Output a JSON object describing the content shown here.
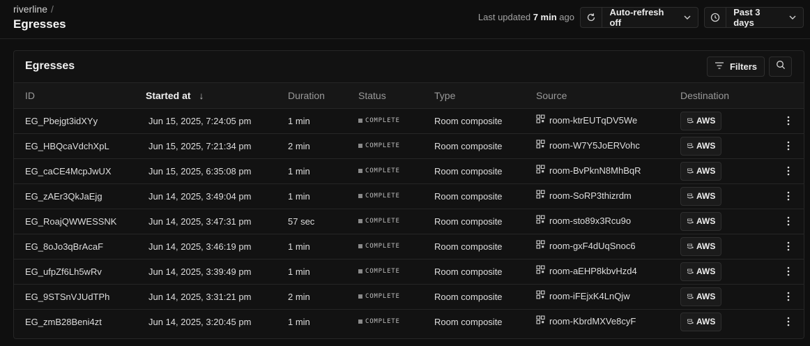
{
  "header": {
    "org": "riverline",
    "sep": "/",
    "title": "Egresses",
    "last_updated_prefix": "Last updated",
    "last_updated_value": "7 min",
    "last_updated_suffix": "ago",
    "autorefresh_label": "Auto-refresh off",
    "range_label": "Past 3 days"
  },
  "panel": {
    "title": "Egresses",
    "filters_label": "Filters"
  },
  "table": {
    "columns": [
      "ID",
      "Started at",
      "Duration",
      "Status",
      "Type",
      "Source",
      "Destination"
    ],
    "sort_arrow": "↓",
    "rows": [
      {
        "id": "EG_Pbejgt3idXYy",
        "started": "Jun 15, 2025, 7:24:05 pm",
        "duration": "1 min",
        "status": "COMPLETE",
        "type": "Room composite",
        "source": "room-ktrEUTqDV5We",
        "dest": "AWS"
      },
      {
        "id": "EG_HBQcaVdchXpL",
        "started": "Jun 15, 2025, 7:21:34 pm",
        "duration": "2 min",
        "status": "COMPLETE",
        "type": "Room composite",
        "source": "room-W7Y5JoERVohc",
        "dest": "AWS"
      },
      {
        "id": "EG_caCE4McpJwUX",
        "started": "Jun 15, 2025, 6:35:08 pm",
        "duration": "1 min",
        "status": "COMPLETE",
        "type": "Room composite",
        "source": "room-BvPknN8MhBqR",
        "dest": "AWS"
      },
      {
        "id": "EG_zAEr3QkJaEjg",
        "started": "Jun 14, 2025, 3:49:04 pm",
        "duration": "1 min",
        "status": "COMPLETE",
        "type": "Room composite",
        "source": "room-SoRP3thizrdm",
        "dest": "AWS"
      },
      {
        "id": "EG_RoajQWWESSNK",
        "started": "Jun 14, 2025, 3:47:31 pm",
        "duration": "57 sec",
        "status": "COMPLETE",
        "type": "Room composite",
        "source": "room-sto89x3Rcu9o",
        "dest": "AWS"
      },
      {
        "id": "EG_8oJo3qBrAcaF",
        "started": "Jun 14, 2025, 3:46:19 pm",
        "duration": "1 min",
        "status": "COMPLETE",
        "type": "Room composite",
        "source": "room-gxF4dUqSnoc6",
        "dest": "AWS"
      },
      {
        "id": "EG_ufpZf6Lh5wRv",
        "started": "Jun 14, 2025, 3:39:49 pm",
        "duration": "1 min",
        "status": "COMPLETE",
        "type": "Room composite",
        "source": "room-aEHP8kbvHzd4",
        "dest": "AWS"
      },
      {
        "id": "EG_9STSnVJUdTPh",
        "started": "Jun 14, 2025, 3:31:21 pm",
        "duration": "2 min",
        "status": "COMPLETE",
        "type": "Room composite",
        "source": "room-iFEjxK4LnQjw",
        "dest": "AWS"
      },
      {
        "id": "EG_zmB28Beni4zt",
        "started": "Jun 14, 2025, 3:20:45 pm",
        "duration": "1 min",
        "status": "COMPLETE",
        "type": "Room composite",
        "source": "room-KbrdMXVe8cyF",
        "dest": "AWS"
      }
    ]
  },
  "icons": {
    "refresh": "refresh-icon",
    "clock": "clock-icon",
    "chevron": "chevron-down-icon",
    "filter": "filter-icon",
    "search": "search-icon",
    "room": "room-grid-icon",
    "aws": "aws-logo-icon",
    "more": "more-vertical-icon"
  }
}
